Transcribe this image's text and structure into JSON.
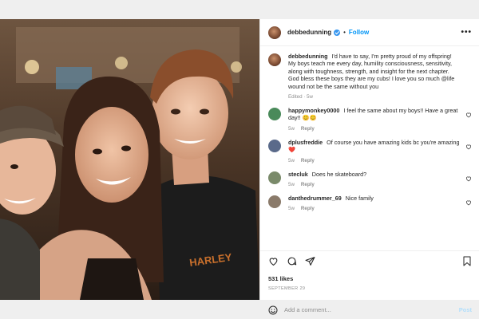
{
  "post": {
    "author": "debbedunning",
    "follow_label": "Follow",
    "separator": "•",
    "more_label": "•••",
    "caption": {
      "username": "debbedunning",
      "text": "I'd have to say, I'm pretty proud of my offspring! My boys teach me every day, humility consciousness, sensitivity, along with toughness, strength, and insight for the next chapter. God bless these boys they are my cubs! I love you so much @life wound not be the same without you",
      "meta": "Edited · 5w"
    },
    "likes": "531 likes",
    "date": "SEPTEMBER 29"
  },
  "comments": [
    {
      "username": "happymonkey0000",
      "text": "I feel the same about my boys!! Have a great day!! 😊😊",
      "time": "5w",
      "reply": "Reply",
      "avatar_color": "#4a8a5a"
    },
    {
      "username": "dplusfreddie",
      "text": "Of course you have amazing kids bc you're amazing ❤️",
      "time": "5w",
      "reply": "Reply",
      "avatar_color": "#5a6a8a"
    },
    {
      "username": "stecluk",
      "text": "Does he skateboard?",
      "time": "5w",
      "reply": "Reply",
      "avatar_color": "#7a8a6a"
    },
    {
      "username": "danthedrummer_69",
      "text": "Nice family",
      "time": "5w",
      "reply": "Reply",
      "avatar_color": "#8a7a6a"
    }
  ],
  "comment_box": {
    "placeholder": "Add a comment...",
    "post_label": "Post"
  },
  "icons": {
    "like": "heart-outline",
    "comment": "speech-bubble",
    "share": "paper-plane",
    "save": "bookmark",
    "emoji": "smiley-face"
  },
  "colors": {
    "link_blue": "#0095f6",
    "post_disabled": "#b2dffc",
    "verified": "#3897f0"
  }
}
